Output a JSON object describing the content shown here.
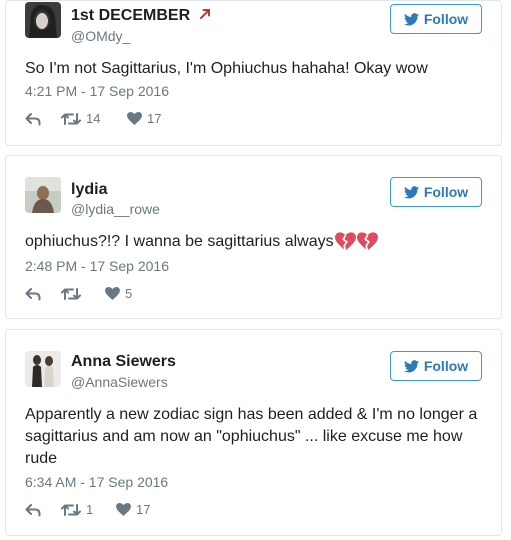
{
  "follow_label": "Follow",
  "accent_color": "#2b7bb9",
  "tweets": [
    {
      "name": "1st DECEMBER",
      "username": "@OMdy_",
      "text": "So I'm not Sagittarius, I'm Ophiuchus hahaha! Okay wow",
      "timestamp": "4:21 PM - 17 Sep 2016",
      "retweets": "14",
      "likes": "17",
      "name_icon": "red-arrow-icon"
    },
    {
      "name": "lydia",
      "username": "@lydia__rowe",
      "text": "ophiuchus?!? I wanna be sagittarius always",
      "text_emoji": "broken-heart-icon x2",
      "timestamp": "2:48 PM - 17 Sep 2016",
      "retweets": "",
      "likes": "5"
    },
    {
      "name": "Anna Siewers",
      "username": "@AnnaSiewers",
      "text": "Apparently a new zodiac sign has been added & I'm no longer a sagittarius and am now an \"ophiuchus\" ... like excuse me how rude",
      "timestamp": "6:34 AM - 17 Sep 2016",
      "retweets": "1",
      "likes": "17"
    }
  ]
}
